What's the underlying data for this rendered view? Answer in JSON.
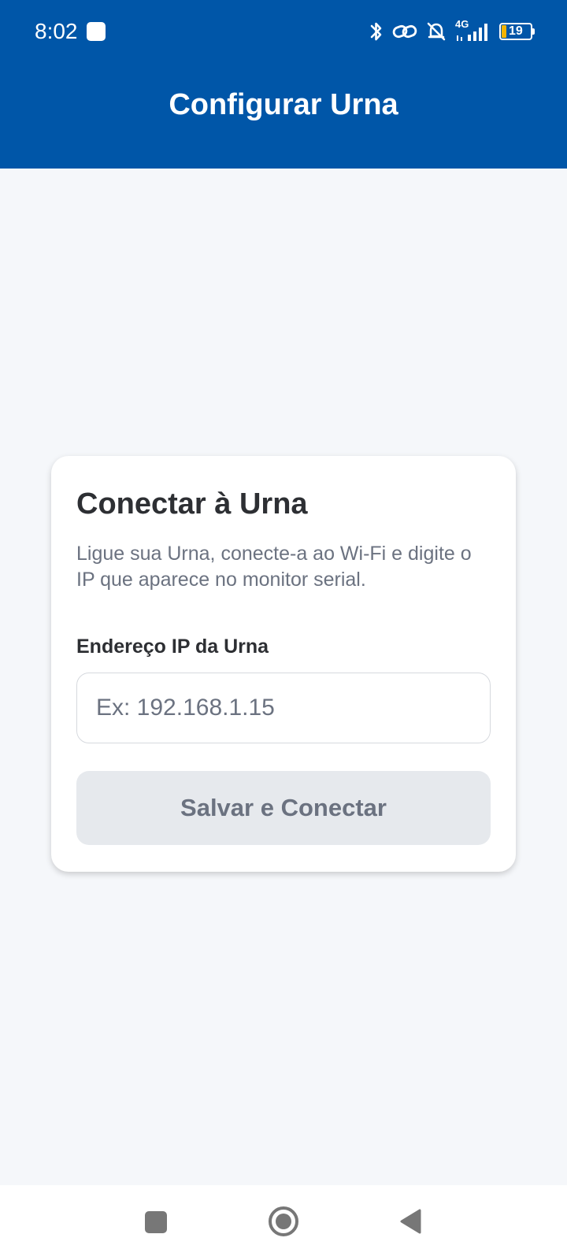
{
  "status_bar": {
    "time": "8:02",
    "network": "4G",
    "battery": "19",
    "icons": [
      "bluetooth-icon",
      "link-icon",
      "bell-muted-icon",
      "signal-icon",
      "battery-icon"
    ]
  },
  "app_bar": {
    "title": "Configurar Urna"
  },
  "card": {
    "title": "Conectar à Urna",
    "description": "Ligue sua Urna, conecte-a ao Wi-Fi e digite o IP que aparece no monitor serial.",
    "ip_label": "Endereço IP da Urna",
    "ip_input": {
      "value": "",
      "placeholder": "Ex: 192.168.1.15"
    },
    "save_button_label": "Salvar e Conectar"
  },
  "nav_bar": {
    "buttons": [
      "recents-button",
      "home-button",
      "back-button"
    ]
  },
  "colors": {
    "primary": "#0056a8",
    "background": "#f5f7fa",
    "card": "#ffffff",
    "text_dark": "#2d2f33",
    "text_muted": "#6b7280",
    "button_disabled": "#e6e9ed"
  }
}
